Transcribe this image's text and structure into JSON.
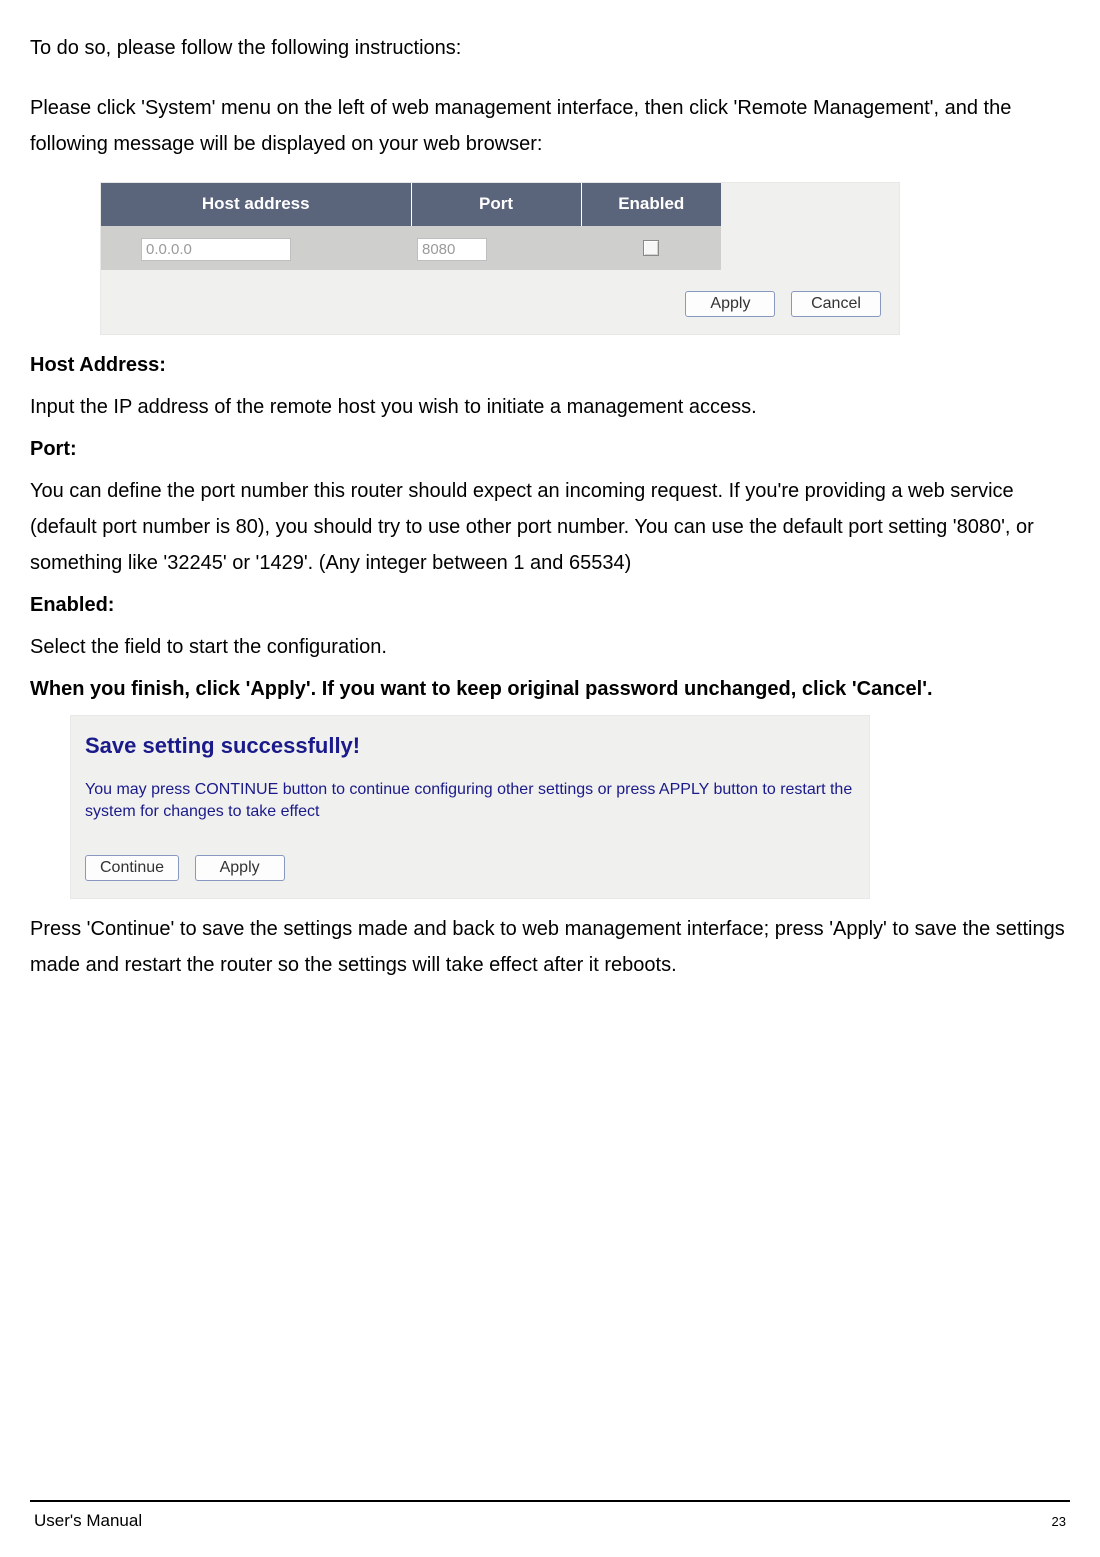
{
  "intro1": "To do so, please follow the following instructions:",
  "intro2": "Please click 'System' menu on the left of web management interface, then click 'Remote Management', and the following message will be displayed on your web browser:",
  "table": {
    "headers": {
      "host": "Host address",
      "port": "Port",
      "enabled": "Enabled"
    },
    "values": {
      "host": "0.0.0.0",
      "port": "8080"
    },
    "buttons": {
      "apply": "Apply",
      "cancel": "Cancel"
    }
  },
  "defs": {
    "host_label": "Host Address:",
    "host_text": "Input the IP address of the remote host you wish to initiate a management access.",
    "port_label": "Port:",
    "port_text": "You can define the port number this router should expect an incoming request. If you're providing a web service (default port number is 80), you should try to use other port number. You can use the default port setting '8080', or something like '32245' or '1429'. (Any integer between 1 and 65534)",
    "enabled_label": "Enabled:",
    "enabled_text": "Select the field to start the configuration.",
    "finish": "When you finish, click 'Apply'. If you want to keep original password unchanged, click 'Cancel'."
  },
  "save_panel": {
    "title": "Save setting successfully!",
    "desc": "You may press CONTINUE button to continue configuring other settings or press APPLY button to restart the system for changes to take effect",
    "continue": "Continue",
    "apply": "Apply"
  },
  "after_save": "Press 'Continue' to save the settings made and back to web management interface; press 'Apply' to save the settings made and restart the router so the settings will take effect after it reboots.",
  "footer": {
    "left": "User's Manual",
    "right": "23"
  }
}
